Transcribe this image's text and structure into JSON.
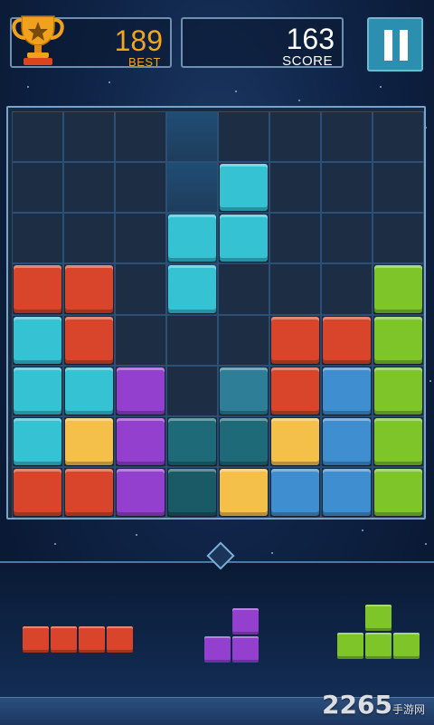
{
  "header": {
    "best_value": "189",
    "best_label": "BEST",
    "score_value": "163",
    "score_label": "SCORE"
  },
  "colors": {
    "red": "#d9452a",
    "cyan": "#35c3d4",
    "purple": "#9340cf",
    "yellow": "#f4c04a",
    "blue": "#3f8fd0",
    "green": "#7ec52a",
    "teal": "#1f6a78",
    "teal_dark": "#195a66",
    "ghost": "#2e7e97"
  },
  "board": {
    "cols": 8,
    "rows": 8,
    "blocks": [
      {
        "col": 4,
        "row": 1,
        "color": "cyan"
      },
      {
        "col": 3,
        "row": 2,
        "color": "cyan"
      },
      {
        "col": 4,
        "row": 2,
        "color": "cyan"
      },
      {
        "col": 3,
        "row": 3,
        "color": "cyan"
      },
      {
        "col": 0,
        "row": 3,
        "color": "red"
      },
      {
        "col": 1,
        "row": 3,
        "color": "red"
      },
      {
        "col": 7,
        "row": 3,
        "color": "green"
      },
      {
        "col": 0,
        "row": 4,
        "color": "cyan"
      },
      {
        "col": 1,
        "row": 4,
        "color": "red"
      },
      {
        "col": 5,
        "row": 4,
        "color": "red"
      },
      {
        "col": 6,
        "row": 4,
        "color": "red"
      },
      {
        "col": 7,
        "row": 4,
        "color": "green"
      },
      {
        "col": 0,
        "row": 5,
        "color": "cyan"
      },
      {
        "col": 1,
        "row": 5,
        "color": "cyan"
      },
      {
        "col": 2,
        "row": 5,
        "color": "purple"
      },
      {
        "col": 4,
        "row": 5,
        "color": "ghost"
      },
      {
        "col": 5,
        "row": 5,
        "color": "red"
      },
      {
        "col": 6,
        "row": 5,
        "color": "blue"
      },
      {
        "col": 7,
        "row": 5,
        "color": "green"
      },
      {
        "col": 0,
        "row": 6,
        "color": "cyan"
      },
      {
        "col": 1,
        "row": 6,
        "color": "yellow"
      },
      {
        "col": 2,
        "row": 6,
        "color": "purple"
      },
      {
        "col": 3,
        "row": 6,
        "color": "teal"
      },
      {
        "col": 4,
        "row": 6,
        "color": "teal"
      },
      {
        "col": 5,
        "row": 6,
        "color": "yellow"
      },
      {
        "col": 6,
        "row": 6,
        "color": "blue"
      },
      {
        "col": 7,
        "row": 6,
        "color": "green"
      },
      {
        "col": 0,
        "row": 7,
        "color": "red"
      },
      {
        "col": 1,
        "row": 7,
        "color": "red"
      },
      {
        "col": 2,
        "row": 7,
        "color": "purple"
      },
      {
        "col": 3,
        "row": 7,
        "color": "teal_dark"
      },
      {
        "col": 4,
        "row": 7,
        "color": "yellow"
      },
      {
        "col": 5,
        "row": 7,
        "color": "blue"
      },
      {
        "col": 6,
        "row": 7,
        "color": "blue"
      },
      {
        "col": 7,
        "row": 7,
        "color": "green"
      }
    ]
  },
  "tray": {
    "pieces": [
      {
        "name": "red-i-piece",
        "color": "red",
        "cells": [
          [
            0,
            0
          ],
          [
            1,
            0
          ],
          [
            2,
            0
          ],
          [
            3,
            0
          ]
        ]
      },
      {
        "name": "purple-l-piece",
        "color": "purple",
        "cells": [
          [
            1,
            0
          ],
          [
            0,
            1
          ],
          [
            1,
            1
          ]
        ]
      },
      {
        "name": "green-t-piece",
        "color": "green",
        "cells": [
          [
            1,
            0
          ],
          [
            0,
            1
          ],
          [
            1,
            1
          ],
          [
            2,
            1
          ]
        ]
      }
    ]
  },
  "watermark": {
    "text": "2265",
    "sub": "手游网"
  }
}
